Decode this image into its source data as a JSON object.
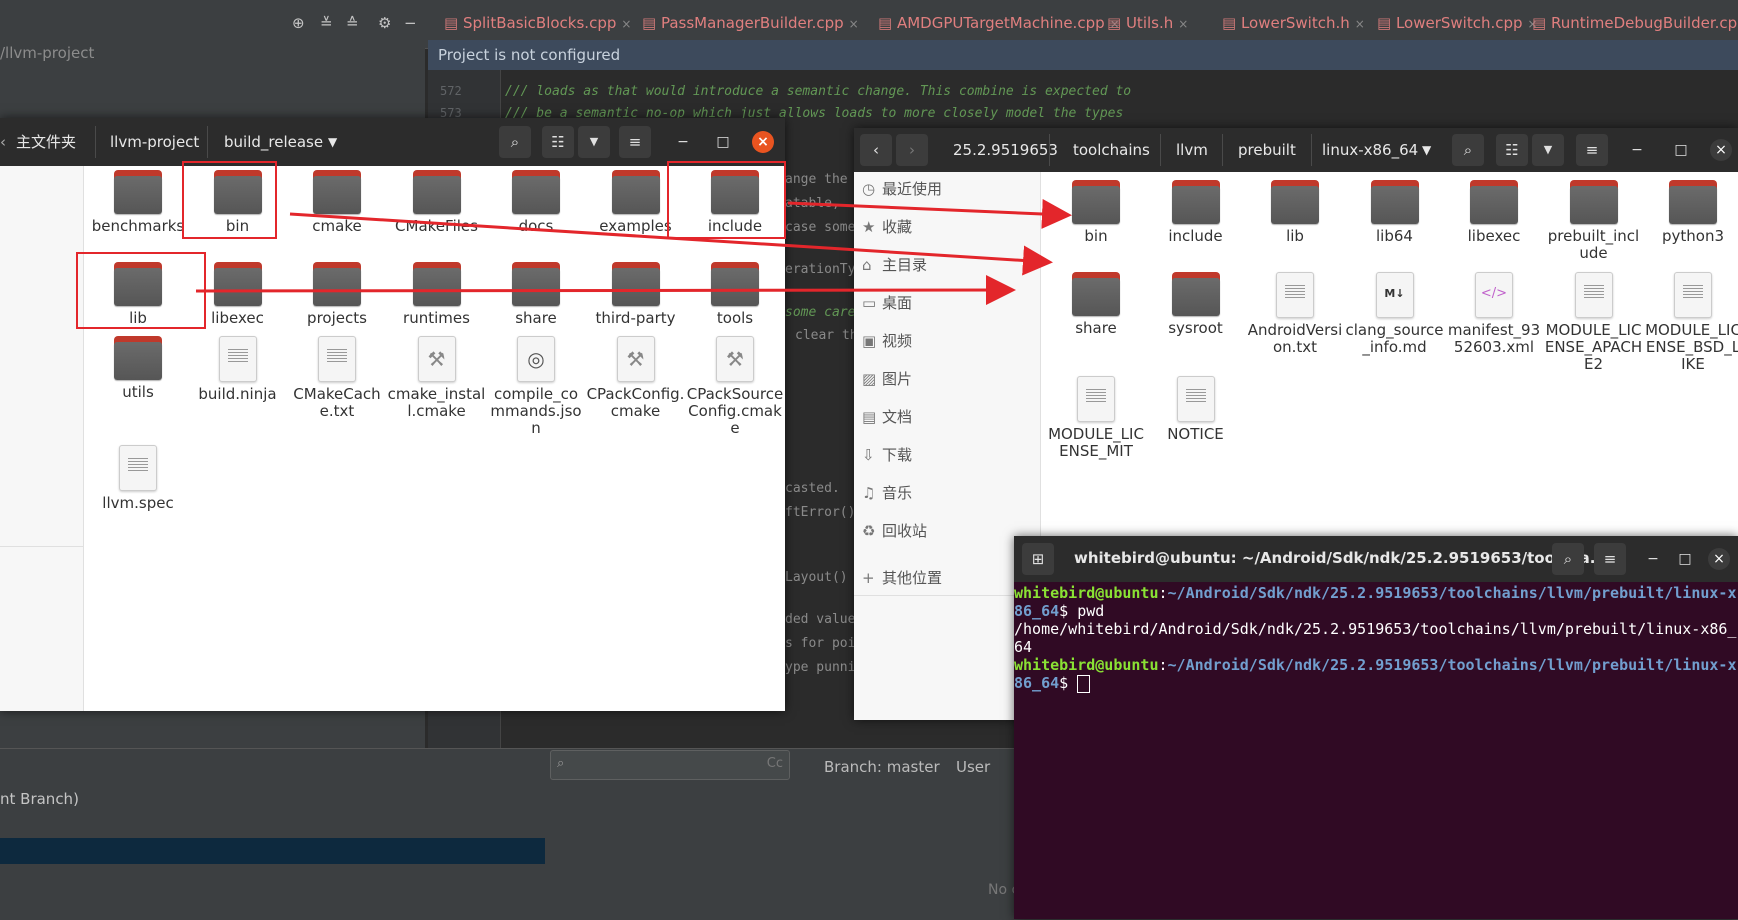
{
  "ide": {
    "tabs": [
      {
        "label": "SplitBasicBlocks.cpp"
      },
      {
        "label": "PassManagerBuilder.cpp"
      },
      {
        "label": "AMDGPUTargetMachine.cpp"
      },
      {
        "label": "Utils.h"
      },
      {
        "label": "LowerSwitch.h"
      },
      {
        "label": "LowerSwitch.cpp"
      },
      {
        "label": "RuntimeDebugBuilder.cpp"
      }
    ],
    "project_path": "/llvm-project",
    "notification": "Project is not configured",
    "line_numbers": [
      "572",
      "573"
    ],
    "code_lines": [
      "/// loads as that would introduce a semantic change. This combine is expected to",
      "/// be a semantic no-op which just allows loads to more closely model the types"
    ],
    "code_fragments": [
      "ange the",
      "atable,",
      "case some",
      "erationTy",
      "some care",
      "clear th",
      "casted.",
      "ftError()",
      "Layout()",
      "ded value",
      "s for poi",
      "ype punni"
    ],
    "bottom": {
      "branch_text": "nt Branch)",
      "branch_label": "Branch: master",
      "user_label": "User",
      "no_changes": "No c"
    }
  },
  "fm1": {
    "breadcrumbs": [
      "主文件夹",
      "llvm-project",
      "build_release"
    ],
    "items": [
      {
        "name": "benchmarks",
        "kind": "folder"
      },
      {
        "name": "bin",
        "kind": "folder"
      },
      {
        "name": "cmake",
        "kind": "folder"
      },
      {
        "name": "CMakeFiles",
        "kind": "folder"
      },
      {
        "name": "docs",
        "kind": "folder"
      },
      {
        "name": "examples",
        "kind": "folder"
      },
      {
        "name": "include",
        "kind": "folder"
      },
      {
        "name": "lib",
        "kind": "folder"
      },
      {
        "name": "libexec",
        "kind": "folder"
      },
      {
        "name": "projects",
        "kind": "folder"
      },
      {
        "name": "runtimes",
        "kind": "folder"
      },
      {
        "name": "share",
        "kind": "folder"
      },
      {
        "name": "third-party",
        "kind": "folder"
      },
      {
        "name": "tools",
        "kind": "folder"
      },
      {
        "name": "utils",
        "kind": "folder"
      },
      {
        "name": "build.ninja",
        "kind": "text"
      },
      {
        "name": "CMakeCache.txt",
        "kind": "text"
      },
      {
        "name": "cmake_install.cmake",
        "kind": "script"
      },
      {
        "name": "compile_commands.json",
        "kind": "json"
      },
      {
        "name": "CPackConfig.cmake",
        "kind": "script"
      },
      {
        "name": "CPackSourceConfig.cmake",
        "kind": "script"
      },
      {
        "name": "llvm.spec",
        "kind": "text"
      }
    ]
  },
  "fm2": {
    "breadcrumbs": [
      "25.2.9519653",
      "toolchains",
      "llvm",
      "prebuilt",
      "linux-x86_64"
    ],
    "sidebar": [
      {
        "label": "最近使用",
        "icon": "clock-icon"
      },
      {
        "label": "收藏",
        "icon": "star-icon"
      },
      {
        "label": "主目录",
        "icon": "home-icon"
      },
      {
        "label": "桌面",
        "icon": "desktop-icon"
      },
      {
        "label": "视频",
        "icon": "video-icon"
      },
      {
        "label": "图片",
        "icon": "image-icon"
      },
      {
        "label": "文档",
        "icon": "document-icon"
      },
      {
        "label": "下载",
        "icon": "download-icon"
      },
      {
        "label": "音乐",
        "icon": "music-icon"
      },
      {
        "label": "回收站",
        "icon": "trash-icon"
      },
      {
        "label": "其他位置",
        "icon": "plus-icon"
      }
    ],
    "items": [
      {
        "name": "bin",
        "kind": "folder"
      },
      {
        "name": "include",
        "kind": "folder"
      },
      {
        "name": "lib",
        "kind": "folder"
      },
      {
        "name": "lib64",
        "kind": "folder"
      },
      {
        "name": "libexec",
        "kind": "folder"
      },
      {
        "name": "prebuilt_include",
        "kind": "folder"
      },
      {
        "name": "python3",
        "kind": "folder"
      },
      {
        "name": "share",
        "kind": "folder"
      },
      {
        "name": "sysroot",
        "kind": "folder"
      },
      {
        "name": "AndroidVersion.txt",
        "kind": "text"
      },
      {
        "name": "clang_source_info.md",
        "kind": "markdown"
      },
      {
        "name": "manifest_9352603.xml",
        "kind": "xml"
      },
      {
        "name": "MODULE_LICENSE_APACHE2",
        "kind": "text"
      },
      {
        "name": "MODULE_LICENSE_BSD_LIKE",
        "kind": "text"
      },
      {
        "name": "MODULE_LICENSE_MIT",
        "kind": "text"
      },
      {
        "name": "NOTICE",
        "kind": "text"
      }
    ]
  },
  "terminal": {
    "title": "whitebird@ubuntu: ~/Android/Sdk/ndk/25.2.9519653/toolcha...",
    "lines": [
      {
        "user": "whitebird@ubuntu",
        "path": "~/Android/Sdk/ndk/25.2.9519653/toolchains/llvm/prebuilt/linux-x"
      },
      {
        "path": "86_64",
        "cmd": "$ pwd"
      },
      {
        "text": "/home/whitebird/Android/Sdk/ndk/25.2.9519653/toolchains/llvm/prebuilt/linux-x86_"
      },
      {
        "text": "64"
      },
      {
        "user": "whitebird@ubuntu",
        "path": "~/Android/Sdk/ndk/25.2.9519653/toolchains/llvm/prebuilt/linux-x"
      },
      {
        "path": "86_64",
        "cmd": "$ "
      }
    ]
  },
  "colors": {
    "annotation_red": "#e3262b",
    "folder_tab": "#c0392b",
    "terminal_bg": "#300a24",
    "prompt_user": "#8ae234",
    "prompt_path": "#729fcf"
  }
}
